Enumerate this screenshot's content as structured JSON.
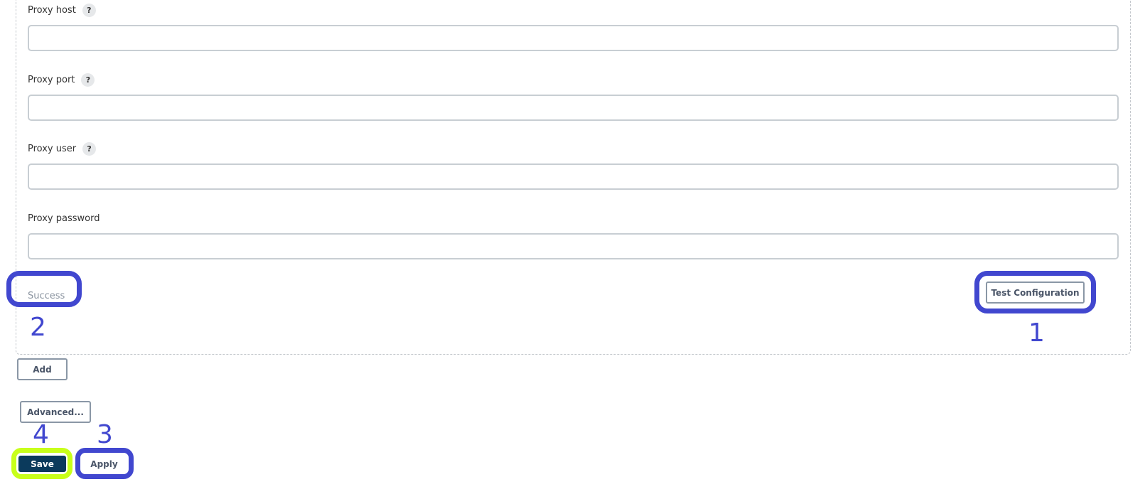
{
  "fields": [
    {
      "label": "Proxy host",
      "help": "?",
      "value": "",
      "placeholder": ""
    },
    {
      "label": "Proxy port",
      "help": "?",
      "value": "",
      "placeholder": ""
    },
    {
      "label": "Proxy user",
      "help": "?",
      "value": "",
      "placeholder": ""
    },
    {
      "label": "Proxy password",
      "value": "",
      "placeholder": ""
    }
  ],
  "status": {
    "text": "Success"
  },
  "buttons": {
    "test_configuration": "Test Configuration",
    "add": "Add",
    "advanced": "Advanced...",
    "save": "Save",
    "apply": "Apply"
  },
  "annotations": {
    "one": "1",
    "two": "2",
    "three": "3",
    "four": "4"
  },
  "colors": {
    "highlight_blue": "#4147cf",
    "highlight_green": "#c8ff1a",
    "save_button_bg": "#0b3a5c"
  }
}
